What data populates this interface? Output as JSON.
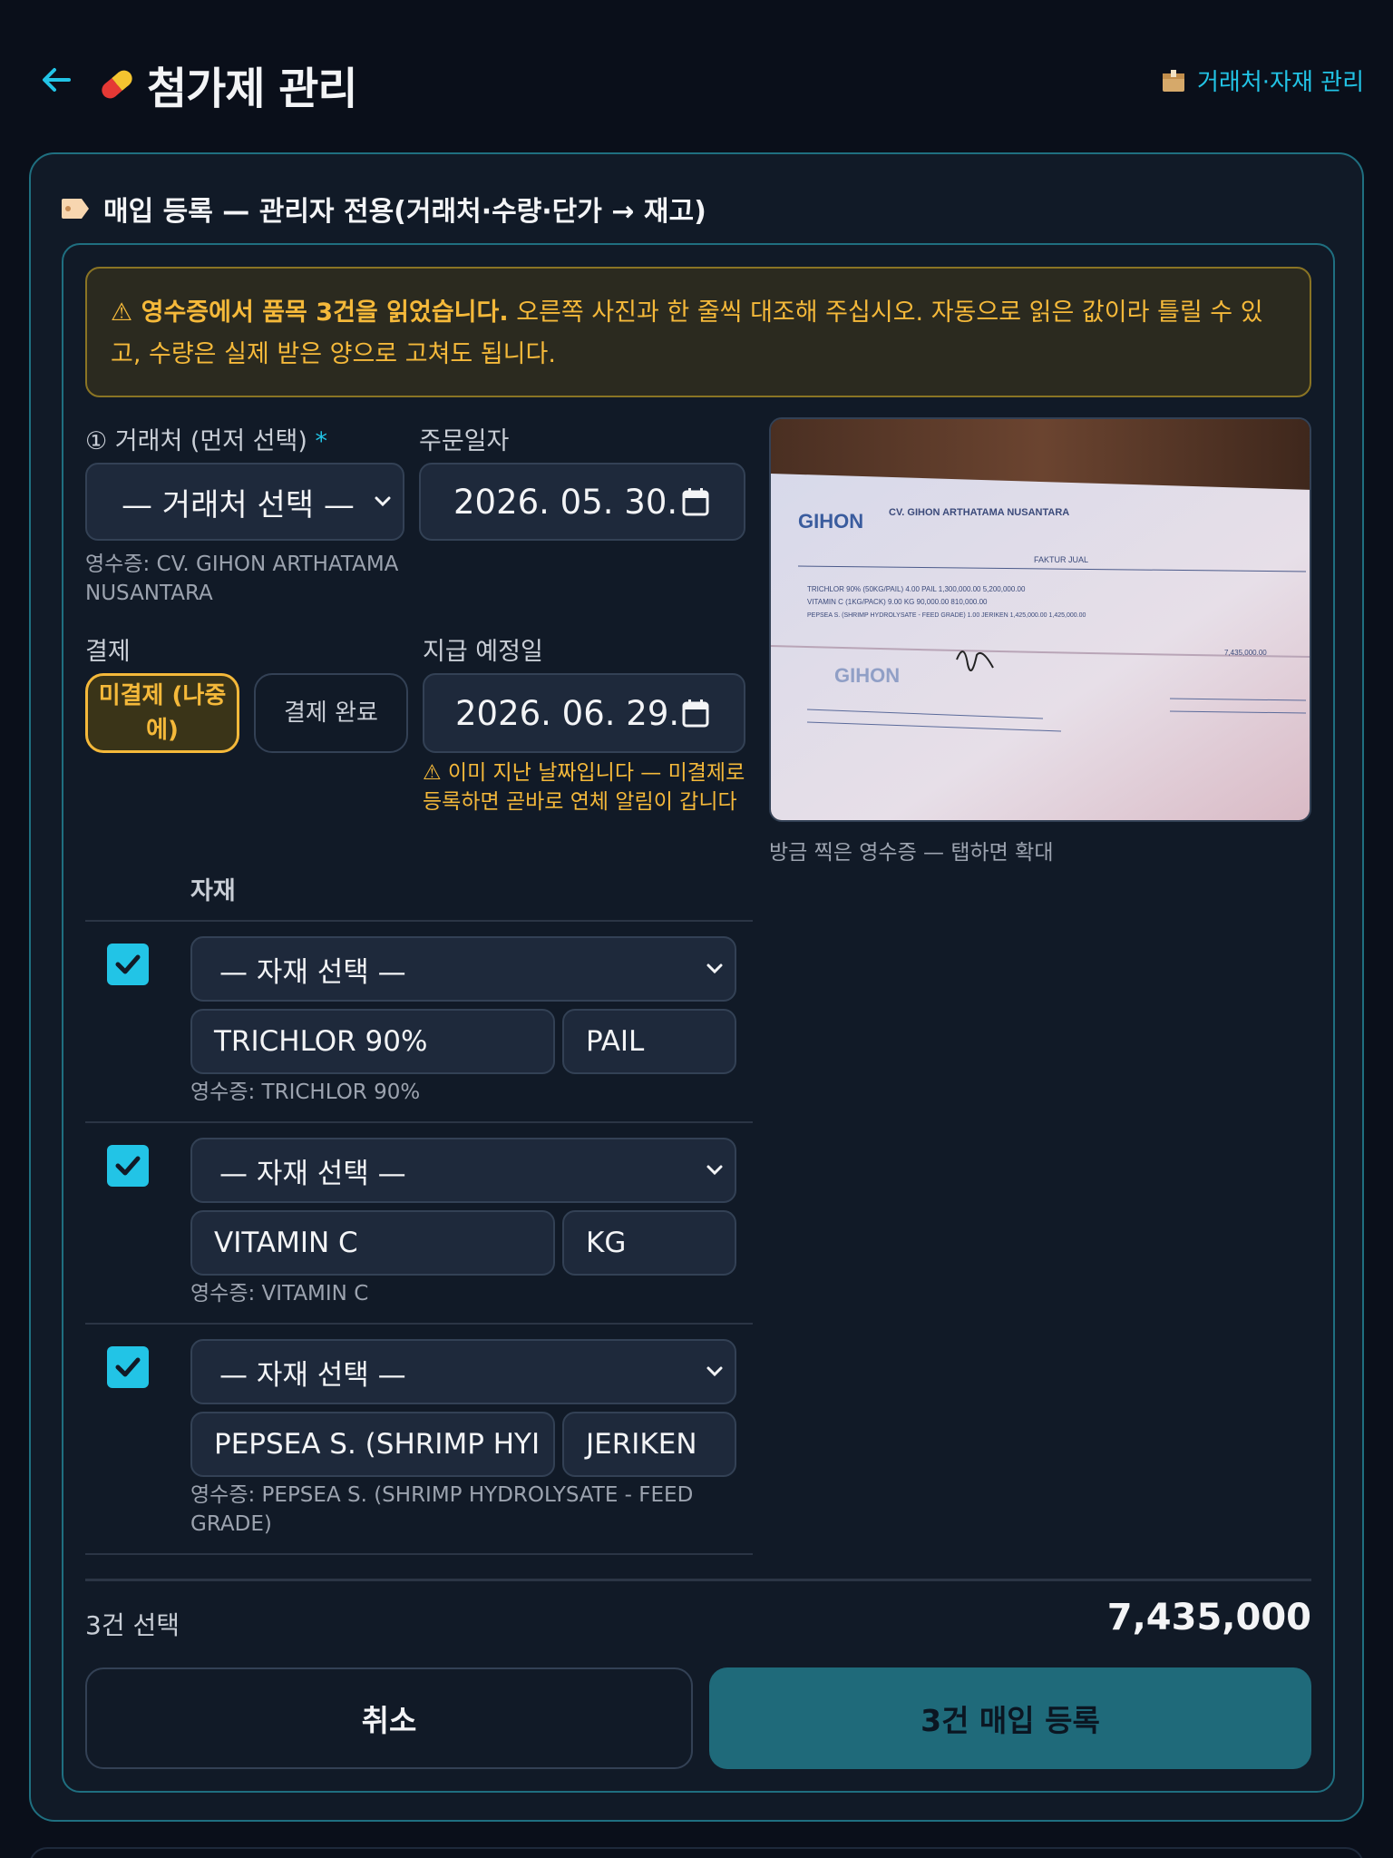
{
  "header": {
    "title": "첨가제 관리",
    "vendor_link": "거래처·자재 관리"
  },
  "section": {
    "title": "매입 등록 — 관리자 전용(거래처·수량·단가 → 재고)"
  },
  "warning": {
    "bold": "⚠ 영수증에서 품목 3건을 읽었습니다.",
    "text": " 오른쪽 사진과 한 줄씩 대조해 주십시오. 자동으로 읽은 값이라 틀릴 수 있고, 수량은 실제 받은 양으로 고쳐도 됩니다."
  },
  "vendor": {
    "label": "① 거래처 (먼저 선택)",
    "required_mark": "*",
    "value": "— 거래처 선택 —",
    "receipt_hint": "영수증: CV. GIHON ARTHATAMA NUSANTARA"
  },
  "order_date": {
    "label": "주문일자",
    "value": "2026. 05. 30."
  },
  "payment": {
    "label": "결제",
    "unpaid_label": "미결제 (나중에)",
    "paid_label": "결제 완료"
  },
  "due_date": {
    "label": "지급 예정일",
    "value": "2026. 06. 29.",
    "warning": "⚠ 이미 지난 날짜입니다 — 미결제로 등록하면 곧바로 연체 알림이 갑니다"
  },
  "photo": {
    "caption": "방금 찍은 영수증 — 탭하면 확대",
    "receipt_company": "CV. GIHON ARTHATAMA NUSANTARA",
    "receipt_heading": "FAKTUR JUAL",
    "receipt_lines": [
      "TRICHLOR 90% (50KG/PAIL)   4.00  PAIL    1,300,000.00   5,200,000.00",
      "VITAMIN C (1KG/PACK)       9.00  KG        90,000.00     810,000.00",
      "PEPSEA S. (SHRIMP HYDROLYSATE - FEED GRADE)  1.00  JERIKEN  1,425,000.00  1,425,000.00"
    ],
    "receipt_total": "7,435,000.00"
  },
  "items": {
    "column_header": "자재",
    "rows": [
      {
        "checked": true,
        "select": "— 자재 선택 —",
        "name": "TRICHLOR 90%",
        "unit": "PAIL",
        "receipt": "영수증: TRICHLOR 90%"
      },
      {
        "checked": true,
        "select": "— 자재 선택 —",
        "name": "VITAMIN C",
        "unit": "KG",
        "receipt": "영수증: VITAMIN C"
      },
      {
        "checked": true,
        "select": "— 자재 선택 —",
        "name": "PEPSEA S. (SHRIMP HYI",
        "unit": "JERIKEN",
        "receipt": "영수증: PEPSEA S. (SHRIMP HYDROLYSATE - FEED GRADE)"
      }
    ]
  },
  "footer": {
    "selected_count": "3건 선택",
    "total": "7,435,000",
    "cancel_label": "취소",
    "submit_label": "3건 매입 등록"
  },
  "colors": {
    "accent": "#22c4e6",
    "warning": "#f5b93a",
    "background": "#0a0f1a",
    "card": "#111a27",
    "border": "#1f6f80"
  },
  "icons": {
    "back": "arrow-left-icon",
    "title": "pill-icon",
    "vendor_link": "box-icon",
    "section": "tag-icon",
    "date": "calendar-icon",
    "select": "chevron-down-icon",
    "check": "checkmark-icon"
  }
}
